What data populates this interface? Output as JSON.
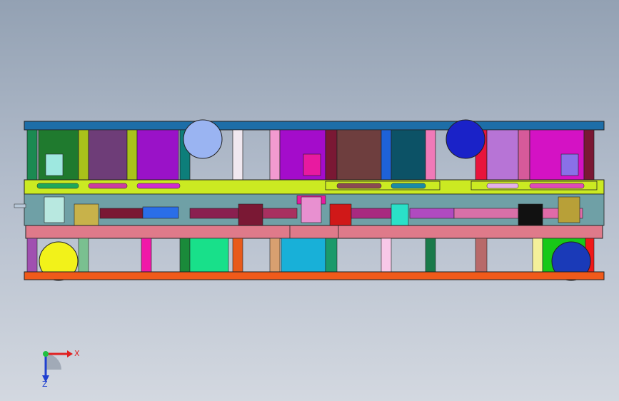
{
  "viewport": {
    "background_top": "#93a1b3",
    "background_bottom": "#d3d8e0"
  },
  "triad": {
    "x_label": "X",
    "z_label": "Z",
    "x_color": "#e02020",
    "y_color": "#20c040",
    "z_color": "#2040d0"
  }
}
